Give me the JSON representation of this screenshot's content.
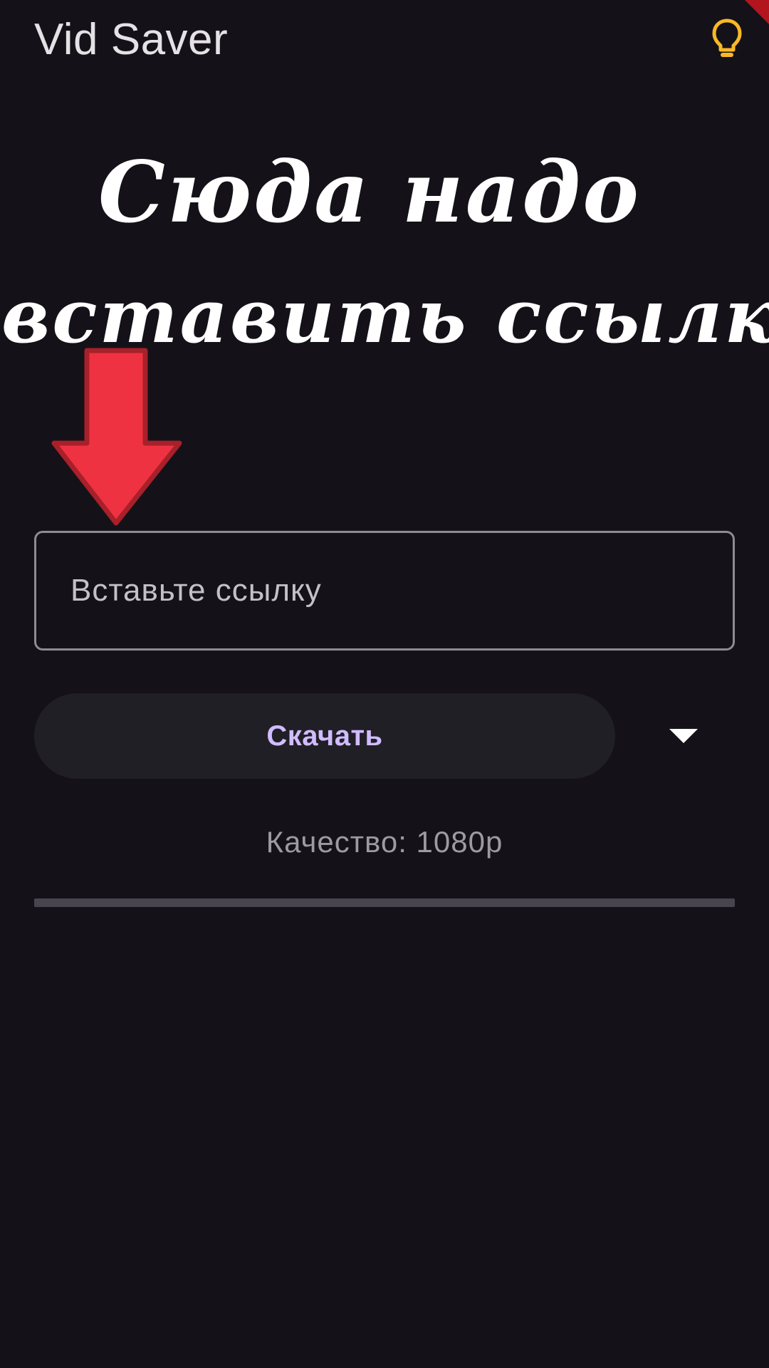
{
  "app": {
    "title": "Vid Saver",
    "theme_icon": "lightbulb-icon",
    "theme_icon_color": "#f9b826"
  },
  "annotation": {
    "line1": "Сюда надо",
    "line2": "вставить ссылку",
    "arrow_icon": "arrow-down-icon",
    "arrow_color": "#ef3241"
  },
  "form": {
    "url_placeholder": "Вставьте ссылку",
    "url_value": "",
    "download_label": "Скачать",
    "dropdown_icon": "triangle-down-icon",
    "quality_text": "Качество: 1080p"
  },
  "progress": {
    "value": 0
  },
  "colors": {
    "background": "#141218",
    "accent": "#d0bcff",
    "button_bg": "#211f26",
    "corner_badge": "#b3151e"
  }
}
